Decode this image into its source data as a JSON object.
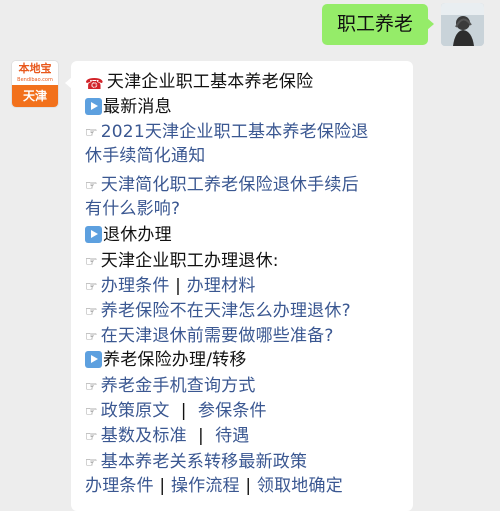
{
  "user_message": "职工养老",
  "bot": {
    "avatar_top": "本地宝",
    "avatar_top_sub": "Bendibao.com",
    "avatar_bottom": "天津"
  },
  "content": {
    "title": "天津企业职工基本养老保险",
    "section1": {
      "heading": "最新消息"
    },
    "l1a": "2021天津企业职工基本养老保险退",
    "l1b": "休手续简化通知",
    "l2a": "天津简化职工养老保险退休手续后",
    "l2b": "有什么影响?",
    "section2": {
      "heading": "退休办理"
    },
    "l3": "天津企业职工办理退休:",
    "l4": {
      "a": "办理条件",
      "sep": " | ",
      "b": "办理材料"
    },
    "l5": "养老保险不在天津怎么办理退休?",
    "l6": "在天津退休前需要做哪些准备?",
    "section3": {
      "heading": "养老保险办理/转移"
    },
    "l7": "养老金手机查询方式",
    "l8": {
      "a": "政策原文",
      "sep": "  |  ",
      "b": "参保条件"
    },
    "l9": {
      "a": "基数及标准",
      "sep": "  |  ",
      "b": "待遇"
    },
    "l10": "基本养老关系转移最新政策",
    "l11": {
      "a": "办理条件",
      "b": "操作流程",
      "c": "领取地确定",
      "sep": " | "
    }
  },
  "icons": {
    "phone": "telephone-icon",
    "play": "play-button-icon",
    "hand": "pointing-hand-icon"
  }
}
